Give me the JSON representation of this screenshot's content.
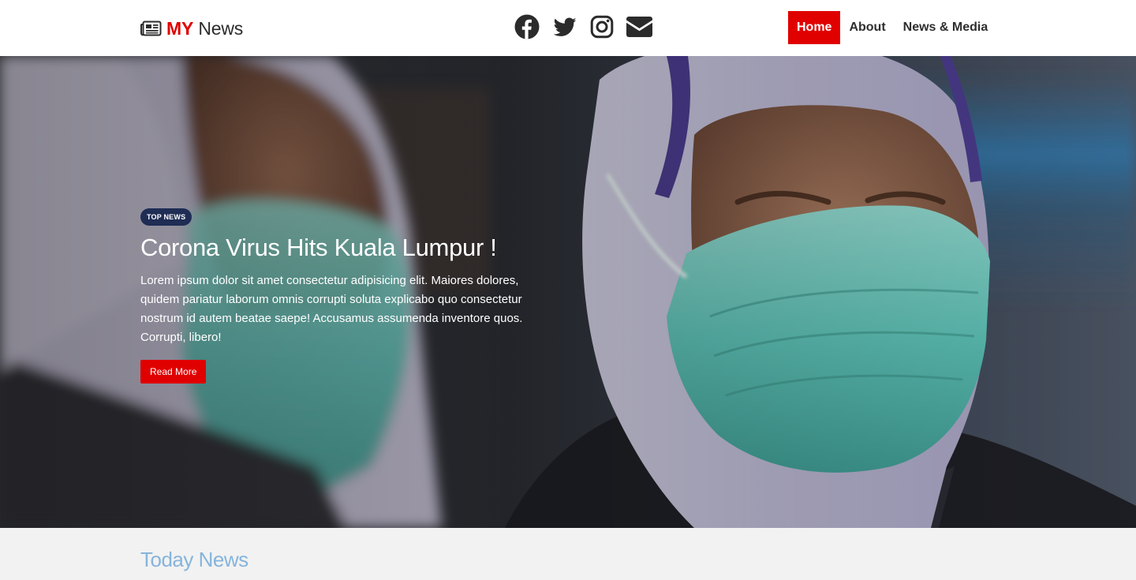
{
  "header": {
    "brand_prefix": "MY",
    "brand_name": "News",
    "brand_icon": "newspaper-icon",
    "socials": [
      {
        "name": "facebook-icon"
      },
      {
        "name": "twitter-icon"
      },
      {
        "name": "instagram-icon"
      },
      {
        "name": "envelope-icon"
      }
    ],
    "nav": {
      "home": "Home",
      "about": "About",
      "media": "News & Media"
    }
  },
  "hero": {
    "badge": "TOP NEWS",
    "title": "Corona Virus Hits Kuala Lumpur !",
    "summary": "Lorem ipsum dolor sit amet consectetur adipisicing elit. Maiores dolores, quidem pariatur laborum omnis corrupti soluta explicabo quo consectetur nostrum id autem beatae saepe! Accusamus assumenda inventore quos. Corrupti, libero!",
    "read_more": "Read More"
  },
  "today": {
    "title": "Today News"
  },
  "colors": {
    "accent": "#e00000",
    "badge": "#1f2d55",
    "section_title": "#86b4dc",
    "icon": "#2b2b2b"
  }
}
